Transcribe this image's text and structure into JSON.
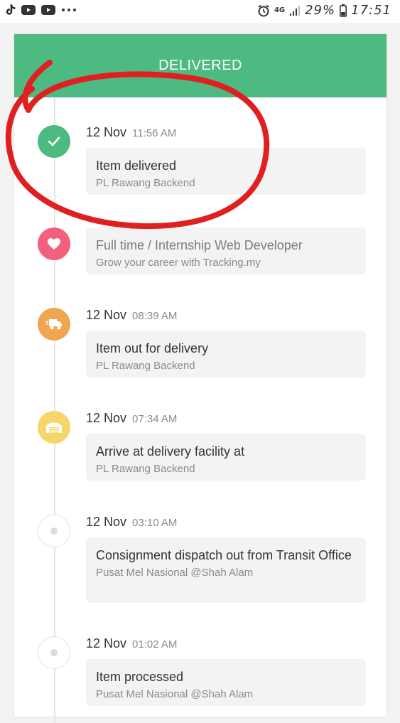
{
  "status_bar": {
    "percent": "29%",
    "time": "17:51",
    "network": "4G"
  },
  "header": {
    "title": "DELIVERED",
    "color": "#4dba82"
  },
  "events": [
    {
      "type": "status",
      "icon": "check-icon",
      "color": "#4dba82",
      "date": "12 Nov",
      "time": "11:56 AM",
      "title": "Item delivered",
      "location": "PL Rawang Backend"
    },
    {
      "type": "ad",
      "icon": "heart-icon",
      "color": "#f2607d",
      "title": "Full time / Internship Web Developer",
      "subtitle": "Grow your career with Tracking.my"
    },
    {
      "type": "status",
      "icon": "delivery-truck-icon",
      "color": "#f0a551",
      "date": "12 Nov",
      "time": "08:39 AM",
      "title": "Item out for delivery",
      "location": "PL Rawang Backend"
    },
    {
      "type": "status",
      "icon": "warehouse-icon",
      "color": "#f5d66a",
      "date": "12 Nov",
      "time": "07:34 AM",
      "title": "Arrive at delivery facility at",
      "location": "PL Rawang Backend"
    },
    {
      "type": "status",
      "icon": "dot-icon",
      "color": "#dcdcdc",
      "date": "12 Nov",
      "time": "03:10 AM",
      "title": "Consignment dispatch out from Transit Office",
      "location": "Pusat Mel Nasional @Shah Alam"
    },
    {
      "type": "status",
      "icon": "dot-icon",
      "color": "#dcdcdc",
      "date": "12 Nov",
      "time": "01:02 AM",
      "title": "Item processed",
      "location": "Pusat Mel Nasional @Shah Alam"
    }
  ],
  "annotation": {
    "color": "#e02020",
    "shape": "hand-drawn circle around latest event"
  }
}
